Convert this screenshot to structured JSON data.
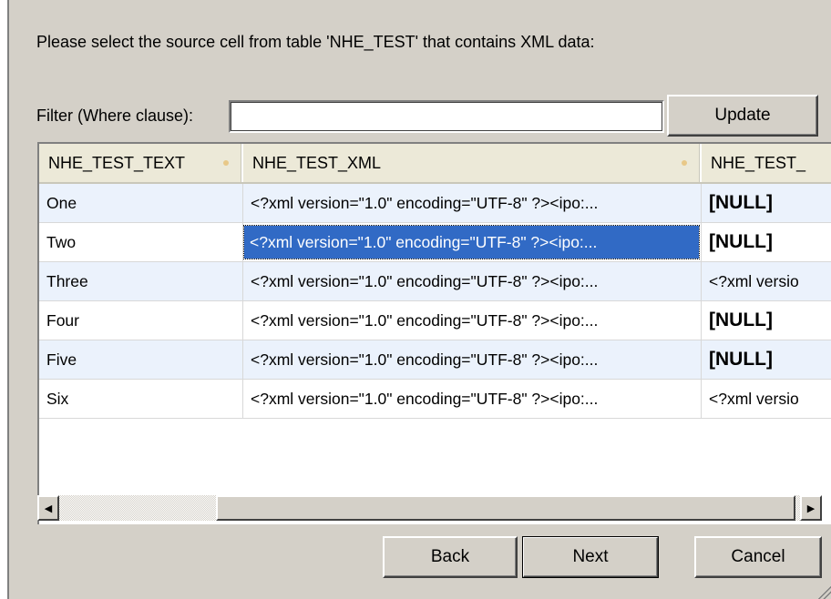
{
  "prompt": "Please select the source cell from table 'NHE_TEST' that contains XML data:",
  "filter": {
    "label": "Filter (Where clause):",
    "value": "",
    "update_label": "Update"
  },
  "grid": {
    "columns": [
      "NHE_TEST_TEXT",
      "NHE_TEST_XML",
      "NHE_TEST_"
    ],
    "rows": [
      {
        "text": "One",
        "xml": "<?xml version=\"1.0\" encoding=\"UTF-8\" ?><ipo:...",
        "extra": "[NULL]"
      },
      {
        "text": "Two",
        "xml": "<?xml version=\"1.0\" encoding=\"UTF-8\" ?><ipo:...",
        "extra": "[NULL]"
      },
      {
        "text": "Three",
        "xml": "<?xml version=\"1.0\" encoding=\"UTF-8\" ?><ipo:...",
        "extra": "<?xml versio"
      },
      {
        "text": "Four",
        "xml": "<?xml version=\"1.0\" encoding=\"UTF-8\" ?><ipo:...",
        "extra": "[NULL]"
      },
      {
        "text": "Five",
        "xml": "<?xml version=\"1.0\" encoding=\"UTF-8\" ?><ipo:...",
        "extra": "[NULL]"
      },
      {
        "text": "Six",
        "xml": "<?xml version=\"1.0\" encoding=\"UTF-8\" ?><ipo:...",
        "extra": "<?xml versio"
      }
    ]
  },
  "scrollbar": {
    "left_icon": "◀",
    "right_icon": "▶"
  },
  "buttons": {
    "back": "Back",
    "next": "Next",
    "cancel": "Cancel"
  },
  "colors": {
    "dialog_bg": "#d4d0c8",
    "selection": "#316ac5",
    "alt_row": "#ebf2fc"
  }
}
